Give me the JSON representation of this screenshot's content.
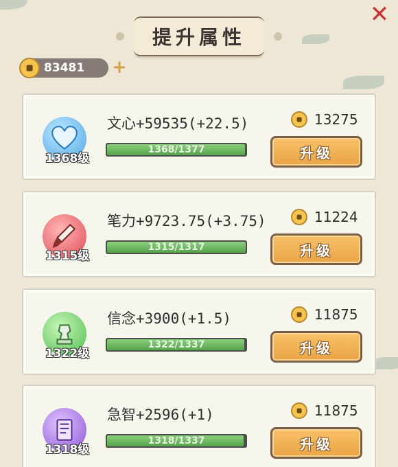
{
  "header": {
    "title": "提升属性",
    "close_icon": "close-icon"
  },
  "currency": {
    "icon": "coin-icon",
    "value": "83481",
    "add_icon": "plus-icon"
  },
  "colors": {
    "accent": "#eaa446",
    "progress": "#56a24c",
    "close": "#c8323a"
  },
  "attributes": [
    {
      "icon": "heart-icon",
      "icon_color": "#4fa8e6",
      "level": "1368级",
      "text": "文心+59535(+22.5)",
      "progress_text": "1368/1377",
      "progress_value": 0.993,
      "cost": "13275",
      "button_label": "升级"
    },
    {
      "icon": "brush-icon",
      "icon_color": "#e04b56",
      "level": "1315级",
      "text": "笔力+9723.75(+3.75)",
      "progress_text": "1315/1317",
      "progress_value": 0.998,
      "cost": "11224",
      "button_label": "升级"
    },
    {
      "icon": "statue-icon",
      "icon_color": "#4fbf4f",
      "level": "1322级",
      "text": "信念+3900(+1.5)",
      "progress_text": "1322/1337",
      "progress_value": 0.989,
      "cost": "11875",
      "button_label": "升级"
    },
    {
      "icon": "scroll-icon",
      "icon_color": "#8b55d6",
      "level": "1318级",
      "text": "急智+2596(+1)",
      "progress_text": "1318/1337",
      "progress_value": 0.986,
      "cost": "11875",
      "button_label": "升级"
    }
  ]
}
